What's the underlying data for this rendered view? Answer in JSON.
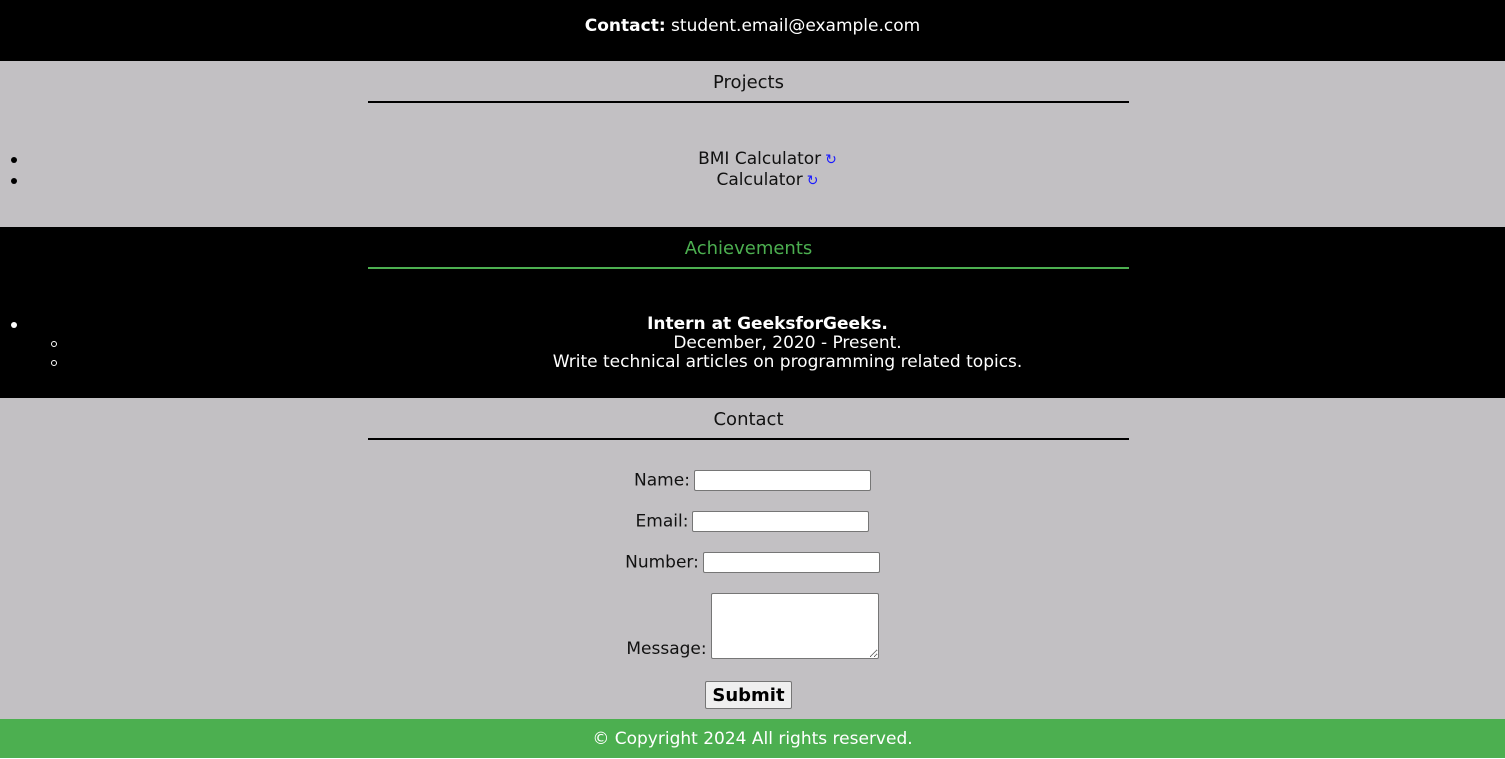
{
  "top_contact": {
    "label": "Contact:",
    "email": "student.email@example.com"
  },
  "projects": {
    "title": "Projects",
    "items": [
      {
        "label": "BMI Calculator",
        "icon": "↻"
      },
      {
        "label": "Calculator",
        "icon": "↻"
      }
    ]
  },
  "achievements": {
    "title": "Achievements",
    "item": "Intern at GeeksforGeeks.",
    "sub_items": [
      "December, 2020 - Present.",
      "Write technical articles on programming related topics."
    ]
  },
  "contact_form": {
    "title": "Contact",
    "name_label": "Name:",
    "email_label": "Email:",
    "number_label": "Number:",
    "message_label": "Message:",
    "name_value": "",
    "email_value": "",
    "number_value": "",
    "message_value": "",
    "submit_label": "Submit"
  },
  "footer": {
    "text": "© Copyright 2024 All rights reserved."
  },
  "colors": {
    "dark_bg": "#000000",
    "light_bg": "#c2c0c3",
    "accent_green": "#4caf50",
    "link_blue": "#1a1aff"
  }
}
